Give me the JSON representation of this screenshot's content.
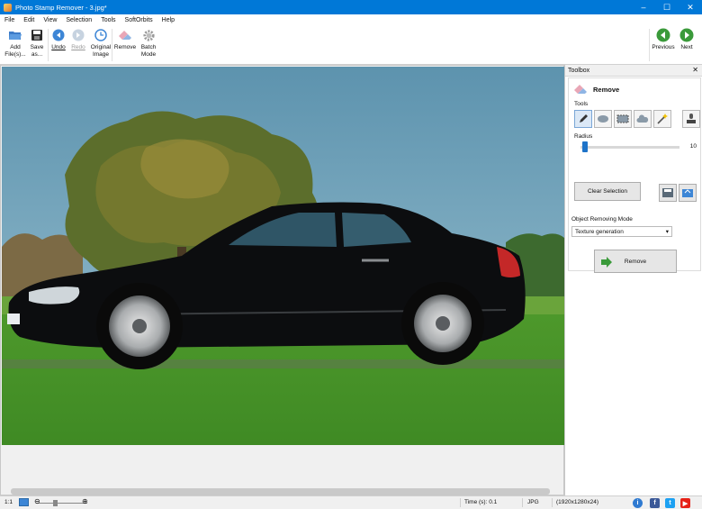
{
  "window": {
    "title": "Photo Stamp Remover - 3.jpg*",
    "minimize": "–",
    "maximize": "☐",
    "close": "✕"
  },
  "menu": [
    "File",
    "Edit",
    "View",
    "Selection",
    "Tools",
    "SoftOrbits",
    "Help"
  ],
  "toolbar": {
    "add_files": [
      "Add",
      "File(s)..."
    ],
    "save_as": [
      "Save",
      "as..."
    ],
    "undo": "Undo",
    "redo": "Redo",
    "original_image": [
      "Original",
      "Image"
    ],
    "remove": "Remove",
    "batch_mode": [
      "Batch",
      "Mode"
    ],
    "previous": "Previous",
    "next": "Next"
  },
  "toolbox": {
    "title": "Toolbox",
    "close": "✕",
    "section_title": "Remove",
    "tools_label": "Tools",
    "radius_label": "Radius",
    "radius_value": "10",
    "radius_fraction": 0.02,
    "clear_selection": "Clear Selection",
    "mode_label": "Object Removing Mode",
    "mode_value": "Texture generation",
    "remove_button": "Remove"
  },
  "status": {
    "zoom_ratio": "1:1",
    "time": "Time (s): 0.1",
    "format": "JPG",
    "dimensions": "(1920x1280x24)"
  },
  "colors": {
    "accent": "#0078d7",
    "facebook": "#3b5998",
    "twitter": "#1da1f2",
    "youtube": "#e62117",
    "info": "#2f7ad1"
  }
}
